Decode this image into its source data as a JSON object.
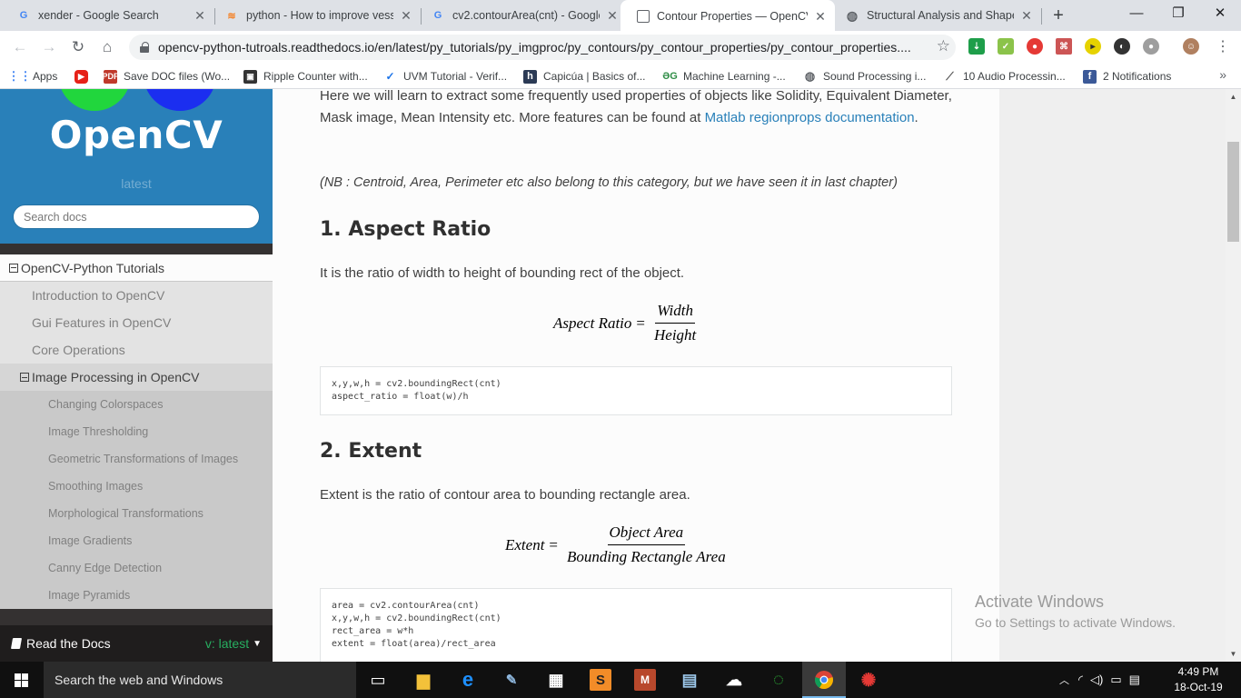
{
  "browser": {
    "tabs": [
      {
        "title": "xender - Google Search",
        "icon": "google-icon",
        "active": false
      },
      {
        "title": "python - How to improve vess",
        "icon": "stackoverflow-icon",
        "active": false
      },
      {
        "title": "cv2.contourArea(cnt) - Google",
        "icon": "google-icon",
        "active": false
      },
      {
        "title": "Contour Properties — OpenCV",
        "icon": "doc-page-icon",
        "active": true
      },
      {
        "title": "Structural Analysis and Shape",
        "icon": "globe-icon",
        "active": false
      }
    ],
    "url": "opencv-python-tutroals.readthedocs.io/en/latest/py_tutorials/py_imgproc/py_contours/py_contour_properties/py_contour_properties....",
    "bookmarks": [
      {
        "label": "Apps",
        "icon": "apps-grid-icon"
      },
      {
        "label": "",
        "icon": "youtube-icon"
      },
      {
        "label": "Save DOC files (Wo...",
        "icon": "pdf-icon"
      },
      {
        "label": "Ripple Counter with...",
        "icon": "bookmark-square-icon"
      },
      {
        "label": "UVM Tutorial - Verif...",
        "icon": "verif-icon"
      },
      {
        "label": "Capicúa | Basics of...",
        "icon": "h-icon"
      },
      {
        "label": "Machine Learning -...",
        "icon": "gfg-icon"
      },
      {
        "label": "Sound Processing i...",
        "icon": "globe-icon"
      },
      {
        "label": "10 Audio Processin...",
        "icon": "chart-icon"
      },
      {
        "label": "2 Notifications",
        "icon": "facebook-icon"
      }
    ]
  },
  "sidebar": {
    "logo_text": "OpenCV",
    "version": "latest",
    "search_placeholder": "Search docs",
    "nav": {
      "root": "OpenCV-Python Tutorials",
      "level2": [
        "Introduction to OpenCV",
        "Gui Features in OpenCV",
        "Core Operations"
      ],
      "current": "Image Processing in OpenCV",
      "level3": [
        "Changing Colorspaces",
        "Image Thresholding",
        "Geometric Transformations of Images",
        "Smoothing Images",
        "Morphological Transformations",
        "Image Gradients",
        "Canny Edge Detection",
        "Image Pyramids"
      ]
    },
    "footer": {
      "label": "Read the Docs",
      "version": "v: latest"
    }
  },
  "content": {
    "intro_text": "Here we will learn to extract some frequently used properties of objects like Solidity, Equivalent Diameter, Mask image, Mean Intensity etc. More features can be found at ",
    "intro_link": "Matlab regionprops documentation",
    "intro_end": ".",
    "note": "(NB : Centroid, Area, Perimeter etc also belong to this category, but we have seen it in last chapter)",
    "sections": [
      {
        "heading": "1. Aspect Ratio",
        "text": "It is the ratio of width to height of bounding rect of the object.",
        "formula_lhs": "Aspect Ratio",
        "formula_num": "Width",
        "formula_den": "Height",
        "code": "x,y,w,h = cv2.boundingRect(cnt)\naspect_ratio = float(w)/h"
      },
      {
        "heading": "2. Extent",
        "text": "Extent is the ratio of contour area to bounding rectangle area.",
        "formula_lhs": "Extent",
        "formula_num": "Object Area",
        "formula_den": "Bounding Rectangle Area",
        "code": "area = cv2.contourArea(cnt)\nx,y,w,h = cv2.boundingRect(cnt)\nrect_area = w*h\nextent = float(area)/rect_area"
      }
    ]
  },
  "watermark": {
    "line1": "Activate Windows",
    "line2": "Go to Settings to activate Windows."
  },
  "taskbar": {
    "search_text": "Search the web and Windows",
    "time": "4:49 PM",
    "date": "18-Oct-19"
  },
  "colors": {
    "rtd_blue": "#2980b9",
    "sidebar_dark": "#343131",
    "link": "#2980b9",
    "rtd_version_green": "#27ae60"
  }
}
